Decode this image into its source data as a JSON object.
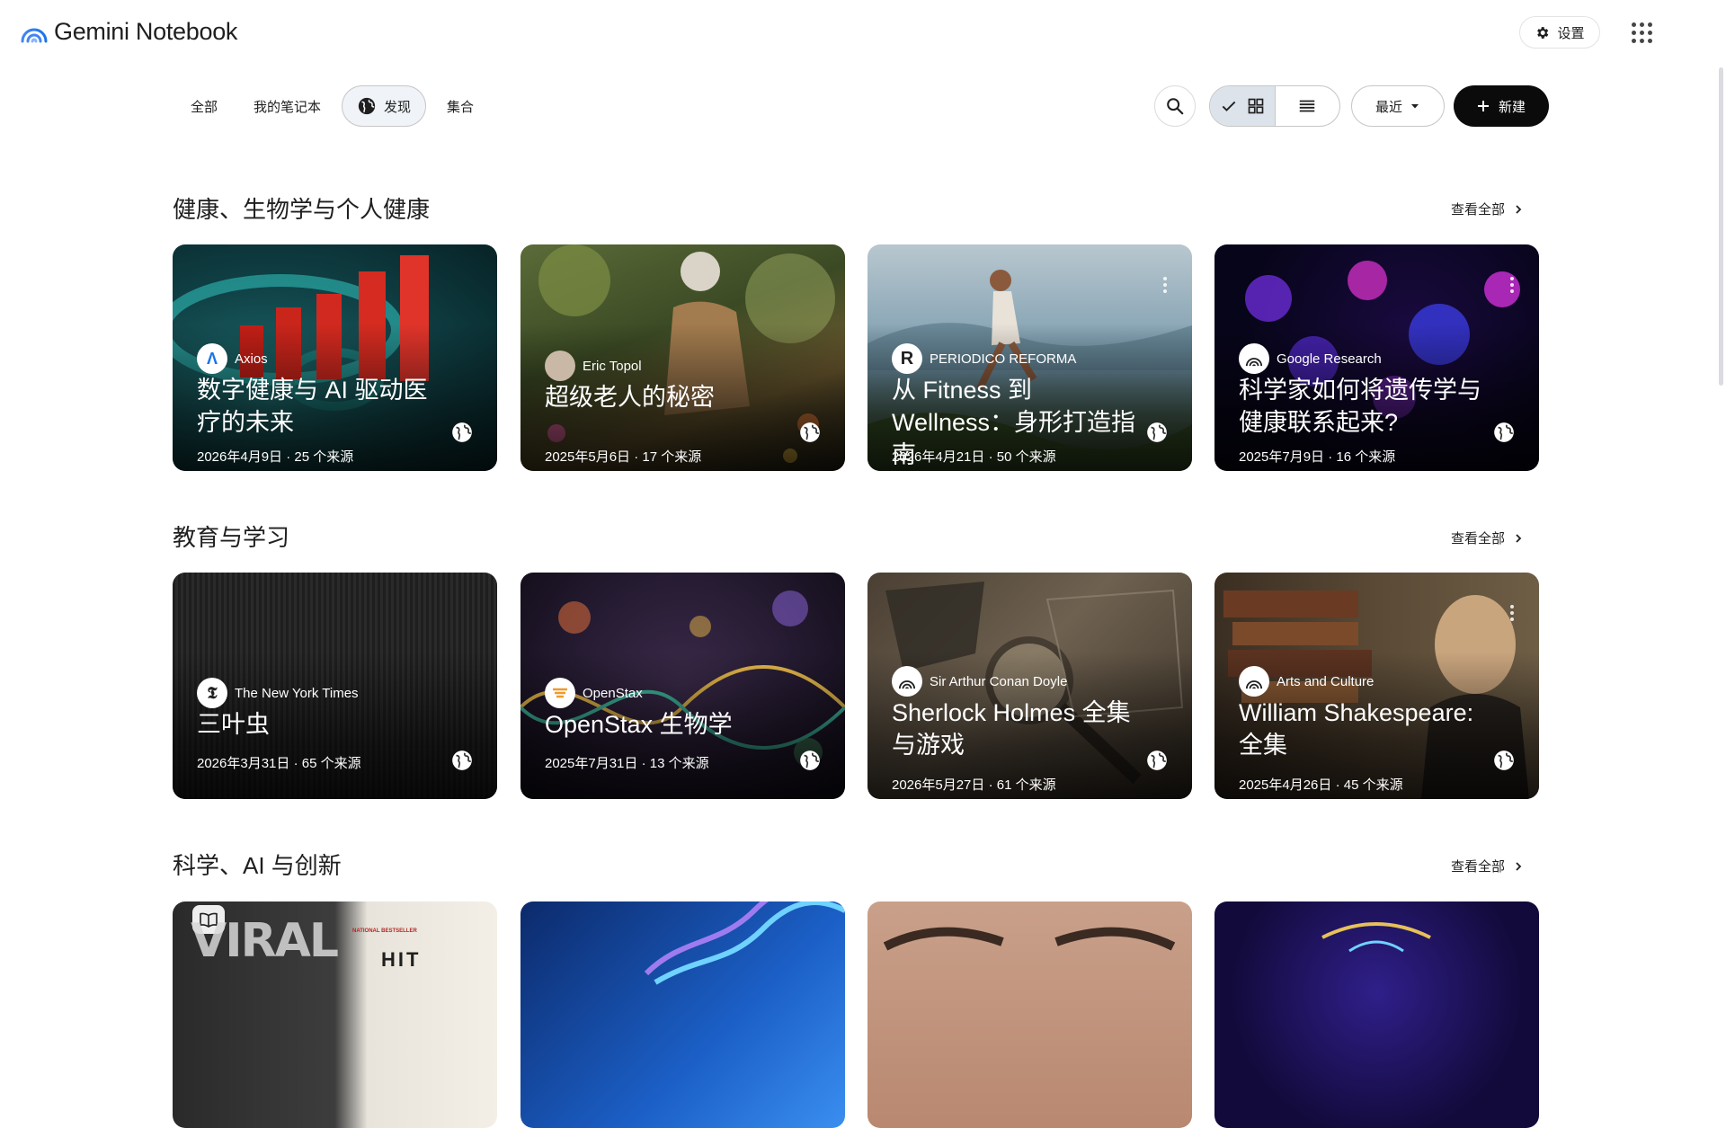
{
  "app": {
    "title": "Gemini Notebook"
  },
  "header": {
    "settings_label": "设置"
  },
  "tabs": [
    {
      "label": "全部"
    },
    {
      "label": "我的笔记本"
    },
    {
      "label": "发现",
      "active": true
    },
    {
      "label": "集合"
    }
  ],
  "toolbar": {
    "sort_label": "最近",
    "new_label": "新建"
  },
  "see_all_label": "查看全部",
  "sections": [
    {
      "title": "健康、生物学与个人健康",
      "cards": [
        {
          "source": "Axios",
          "title": "数字健康与 AI 驱动医疗的未来",
          "meta": "2026年4月9日 · 25 个来源"
        },
        {
          "source": "Eric Topol",
          "title": "超级老人的秘密",
          "meta": "2025年5月6日 · 17 个来源"
        },
        {
          "source": "PERIODICO REFORMA",
          "title": "从 Fitness 到 Wellness：身形打造指南",
          "meta": "2026年4月21日 · 50 个来源"
        },
        {
          "source": "Google Research",
          "title": "科学家如何将遗传学与健康联系起来?",
          "meta": "2025年7月9日 · 16 个来源"
        }
      ]
    },
    {
      "title": "教育与学习",
      "cards": [
        {
          "source": "The New York Times",
          "title": "三叶虫",
          "meta": "2026年3月31日 · 65 个来源"
        },
        {
          "source": "OpenStax",
          "title": "OpenStax 生物学",
          "meta": "2025年7月31日 · 13 个来源"
        },
        {
          "source": "Sir Arthur Conan Doyle",
          "title": "Sherlock Holmes 全集与游戏",
          "meta": "2026年5月27日 · 61 个来源"
        },
        {
          "source": "Arts and Culture",
          "title": "William Shakespeare: 全集",
          "meta": "2025年4月26日 · 45 个来源"
        }
      ]
    },
    {
      "title": "科学、AI 与创新",
      "cards": [
        {
          "image_text": [
            "NATIONAL BESTSELLER",
            "HIT"
          ]
        },
        {},
        {},
        {}
      ]
    }
  ],
  "colors": {
    "accent_dark": "#0b0b0b",
    "active_tab_bg": "#f0f4f9",
    "view_on_bg": "#dde3ea"
  },
  "icons": [
    "gemini-logo-icon",
    "gear-icon",
    "apps-grid-icon",
    "globe-icon",
    "search-icon",
    "check-icon",
    "grid-view-icon",
    "list-view-icon",
    "caret-down-icon",
    "plus-icon",
    "chevron-right-icon",
    "more-vert-icon",
    "open-book-icon"
  ]
}
